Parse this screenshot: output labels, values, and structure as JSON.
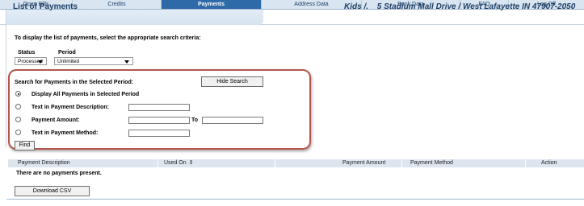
{
  "nav": {
    "tabs": [
      {
        "label": "Open Bills",
        "active": false
      },
      {
        "label": "Credits",
        "active": false
      },
      {
        "label": "Payments",
        "active": true
      },
      {
        "label": "Address Data",
        "active": false
      },
      {
        "label": "Bank Data",
        "active": false
      },
      {
        "label": "FAQ",
        "active": false
      },
      {
        "label": "Log Off",
        "active": false
      }
    ]
  },
  "header": {
    "page_title": "List of Payments",
    "account_name": "Kids /.",
    "address": "5 Stadium Mall Drive / West Lafayette IN 47907-2050"
  },
  "instructions": "To display the list of payments, select the appropriate search criteria:",
  "filters": {
    "status_label": "Status",
    "status_value": "Processed",
    "period_label": "Period",
    "period_value": "Unlimited"
  },
  "search": {
    "heading": "Search for Payments in the Selected Period:",
    "hide_button": "Hide Search",
    "options": [
      {
        "label": "Display All Payments in Selected Period",
        "checked": true
      },
      {
        "label": "Text in Payment Description:",
        "checked": false
      },
      {
        "label": "Payment Amount:",
        "checked": false
      },
      {
        "label": "Text in Payment Method:",
        "checked": false
      }
    ],
    "to_label": "To",
    "find_button": "Find"
  },
  "table": {
    "columns": [
      "Payment Description",
      "Used On",
      "Payment Amount",
      "Payment Method",
      "Action"
    ],
    "empty_message": "There are no payments present."
  },
  "download_button": "Download CSV",
  "colors": {
    "active_tab": "#2e6aa7",
    "nav_bg": "#d9e6f2",
    "title_text": "#1d3e66",
    "highlight_border": "#b5564a"
  },
  "icons": {
    "sort": "sort-arrows-icon",
    "dropdown": "chevron-down-icon"
  }
}
